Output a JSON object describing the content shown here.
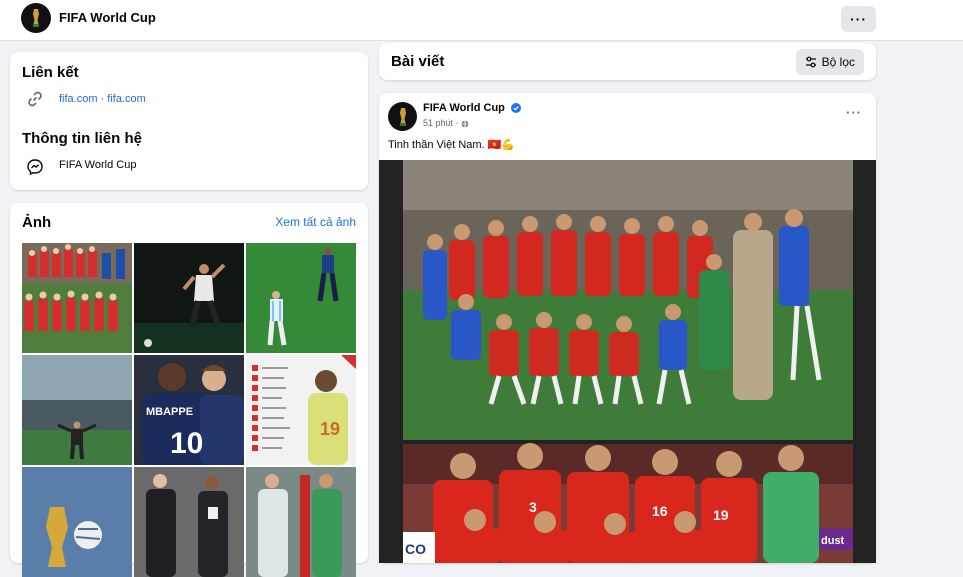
{
  "header": {
    "page_name": "FIFA World Cup",
    "more_icon": "more-dots-icon"
  },
  "intro": {
    "links_heading": "Liên kết",
    "website": "fifa.com · fifa.com",
    "contact_heading": "Thông tin liên hệ",
    "messenger_name": "FIFA World Cup"
  },
  "photos": {
    "heading": "Ảnh",
    "see_all": "Xem tất cả ảnh",
    "tiles": [
      {
        "desc": "Vietnam team celebration",
        "color": "#c62828"
      },
      {
        "desc": "Player celebrating in dark",
        "color": "#1b1f1d"
      },
      {
        "desc": "Players on pitch",
        "color": "#2e7d32"
      },
      {
        "desc": "Goalkeeper in stadium",
        "color": "#5a6d74"
      },
      {
        "desc": "Mbappe and Griezmann",
        "color": "#1a2a55"
      },
      {
        "desc": "Ranking list graphic",
        "color": "#f5f5f5"
      },
      {
        "desc": "World Cup trophy",
        "color": "#4a6e9c"
      },
      {
        "desc": "Coaches on sideline",
        "color": "#4a4a4a"
      },
      {
        "desc": "Goalkeepers",
        "color": "#6a8a7a"
      }
    ],
    "shirt_text": "MBAPPE",
    "shirt_number": "10"
  },
  "posts": {
    "heading": "Bài viết",
    "filter_label": "Bộ lọc"
  },
  "post": {
    "author": "FIFA World Cup",
    "time": "51 phút ·",
    "text": "Tinh thần Việt Nam. 🇻🇳💪",
    "jersey_numbers": [
      "3",
      "16",
      "19"
    ],
    "board_text": "CO",
    "board_text_right": "dust"
  }
}
